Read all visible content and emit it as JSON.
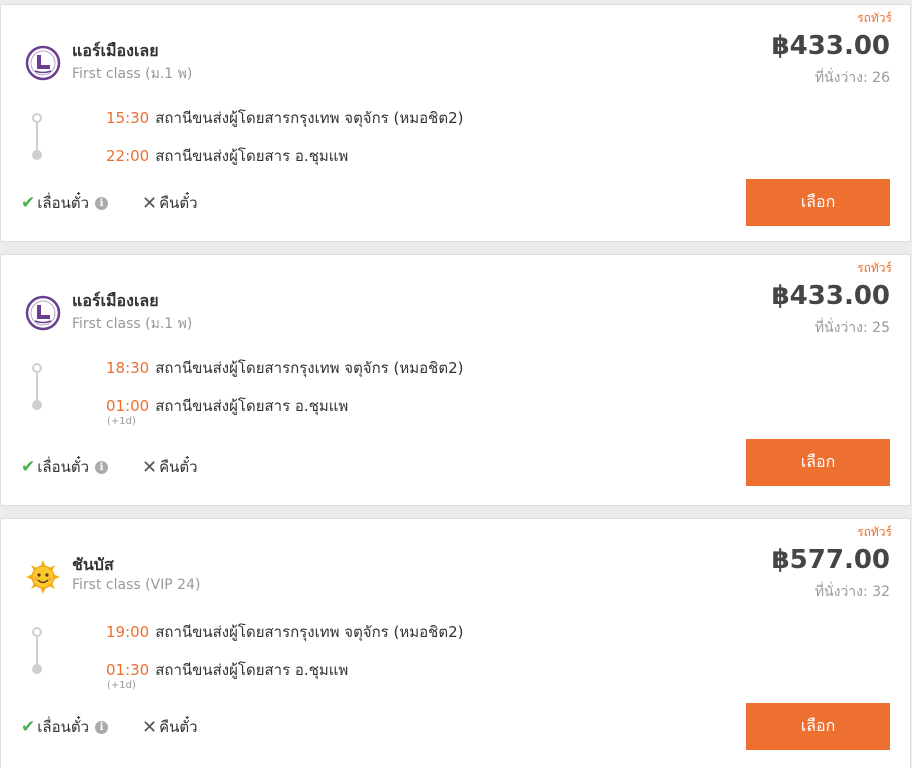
{
  "cards": [
    {
      "tag": "รถทัวร์",
      "operator": "แอร์เมืองเลย",
      "bus_class": "First class (ม.1 พ)",
      "logo": "air-muang-loei-logo",
      "price": "฿433.00",
      "seats": "ที่นั่งว่าง: 26",
      "departure_time": "15:30",
      "departure_station": "สถานีขนส่งผู้โดยสารกรุงเทพ จตุจักร (หมอชิต2)",
      "arrival_time": "22:00",
      "arrival_station": "สถานีขนส่งผู้โดยสาร อ.ชุมแพ",
      "next_day": "",
      "feature_reschedule": "เลื่อนตั๋ว",
      "feature_refund": "คืนตั๋ว",
      "select_label": "เลือก"
    },
    {
      "tag": "รถทัวร์",
      "operator": "แอร์เมืองเลย",
      "bus_class": "First class (ม.1 พ)",
      "logo": "air-muang-loei-logo",
      "price": "฿433.00",
      "seats": "ที่นั่งว่าง: 25",
      "departure_time": "18:30",
      "departure_station": "สถานีขนส่งผู้โดยสารกรุงเทพ จตุจักร (หมอชิต2)",
      "arrival_time": "01:00",
      "arrival_station": "สถานีขนส่งผู้โดยสาร อ.ชุมแพ",
      "next_day": "(+1d)",
      "feature_reschedule": "เลื่อนตั๋ว",
      "feature_refund": "คืนตั๋ว",
      "select_label": "เลือก"
    },
    {
      "tag": "รถทัวร์",
      "operator": "ชันบัส",
      "bus_class": "First class (VIP 24)",
      "logo": "sun-bus-logo",
      "price": "฿577.00",
      "seats": "ที่นั่งว่าง: 32",
      "departure_time": "19:00",
      "departure_station": "สถานีขนส่งผู้โดยสารกรุงเทพ จตุจักร (หมอชิต2)",
      "arrival_time": "01:30",
      "arrival_station": "สถานีขนส่งผู้โดยสาร อ.ชุมแพ",
      "next_day": "(+1d)",
      "feature_reschedule": "เลื่อนตั๋ว",
      "feature_refund": "คืนตั๋ว",
      "select_label": "เลือก"
    }
  ],
  "colors": {
    "accent": "#ee7030",
    "check": "#4caf50",
    "logo_purple": "#6b3f8f"
  },
  "icons": {
    "check": "check-icon",
    "cross": "cross-icon",
    "info": "info-icon"
  }
}
